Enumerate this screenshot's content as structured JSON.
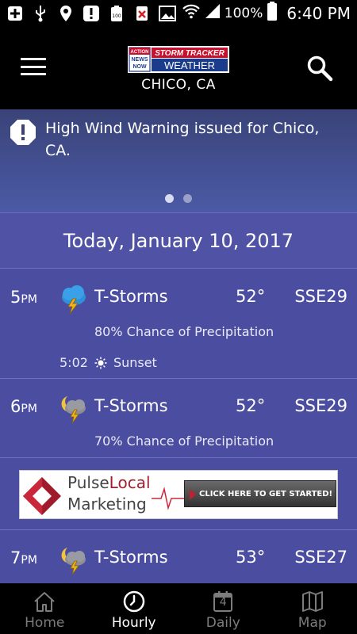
{
  "status_bar": {
    "battery_percent": "100%",
    "time": "6:40 PM",
    "battery_level": 1.0
  },
  "header": {
    "logo": {
      "badge": "ACTION NEWS NOW",
      "line1": "STORM TRACKER",
      "line2": "WEATHER"
    },
    "location": "CHICO, CA"
  },
  "alert": {
    "text": "High Wind Warning issued for Chico, CA.",
    "page_count": 2,
    "active_page": 1
  },
  "date_label": "Today, January 10, 2017",
  "hours": [
    {
      "hour": "5",
      "ampm": "PM",
      "condition": "T-Storms",
      "icon": "thunderstorm-day-icon",
      "temp": "52°",
      "wind": "SSE29",
      "precip": "80% Chance of Precipitation",
      "sun_event": {
        "time": "5:02",
        "label": "Sunset"
      }
    },
    {
      "hour": "6",
      "ampm": "PM",
      "condition": "T-Storms",
      "icon": "thunderstorm-night-icon",
      "temp": "52°",
      "wind": "SSE29",
      "precip": "70% Chance of Precipitation"
    },
    {
      "hour": "7",
      "ampm": "PM",
      "condition": "T-Storms",
      "icon": "thunderstorm-night-icon",
      "temp": "53°",
      "wind": "SSE27"
    }
  ],
  "ad": {
    "brand_part1": "Pulse",
    "brand_part2": "Local",
    "brand_line2": "Marketing",
    "cta": "CLICK HERE TO GET STARTED!"
  },
  "nav": {
    "items": [
      {
        "label": "Home",
        "icon": "home-icon"
      },
      {
        "label": "Hourly",
        "icon": "clock-icon"
      },
      {
        "label": "Daily",
        "icon": "calendar-icon",
        "badge": "4"
      },
      {
        "label": "Map",
        "icon": "map-icon"
      }
    ],
    "active": "Hourly"
  },
  "colors": {
    "page_bg": "#4b4ea0",
    "alert_bg": "#3a4378",
    "date_bg": "#5052a5",
    "nav_bg": "#000000",
    "nav_inactive": "#7c7c7c",
    "bolt": "#f2b21b",
    "rain_cloud": "#2f8fd8"
  }
}
